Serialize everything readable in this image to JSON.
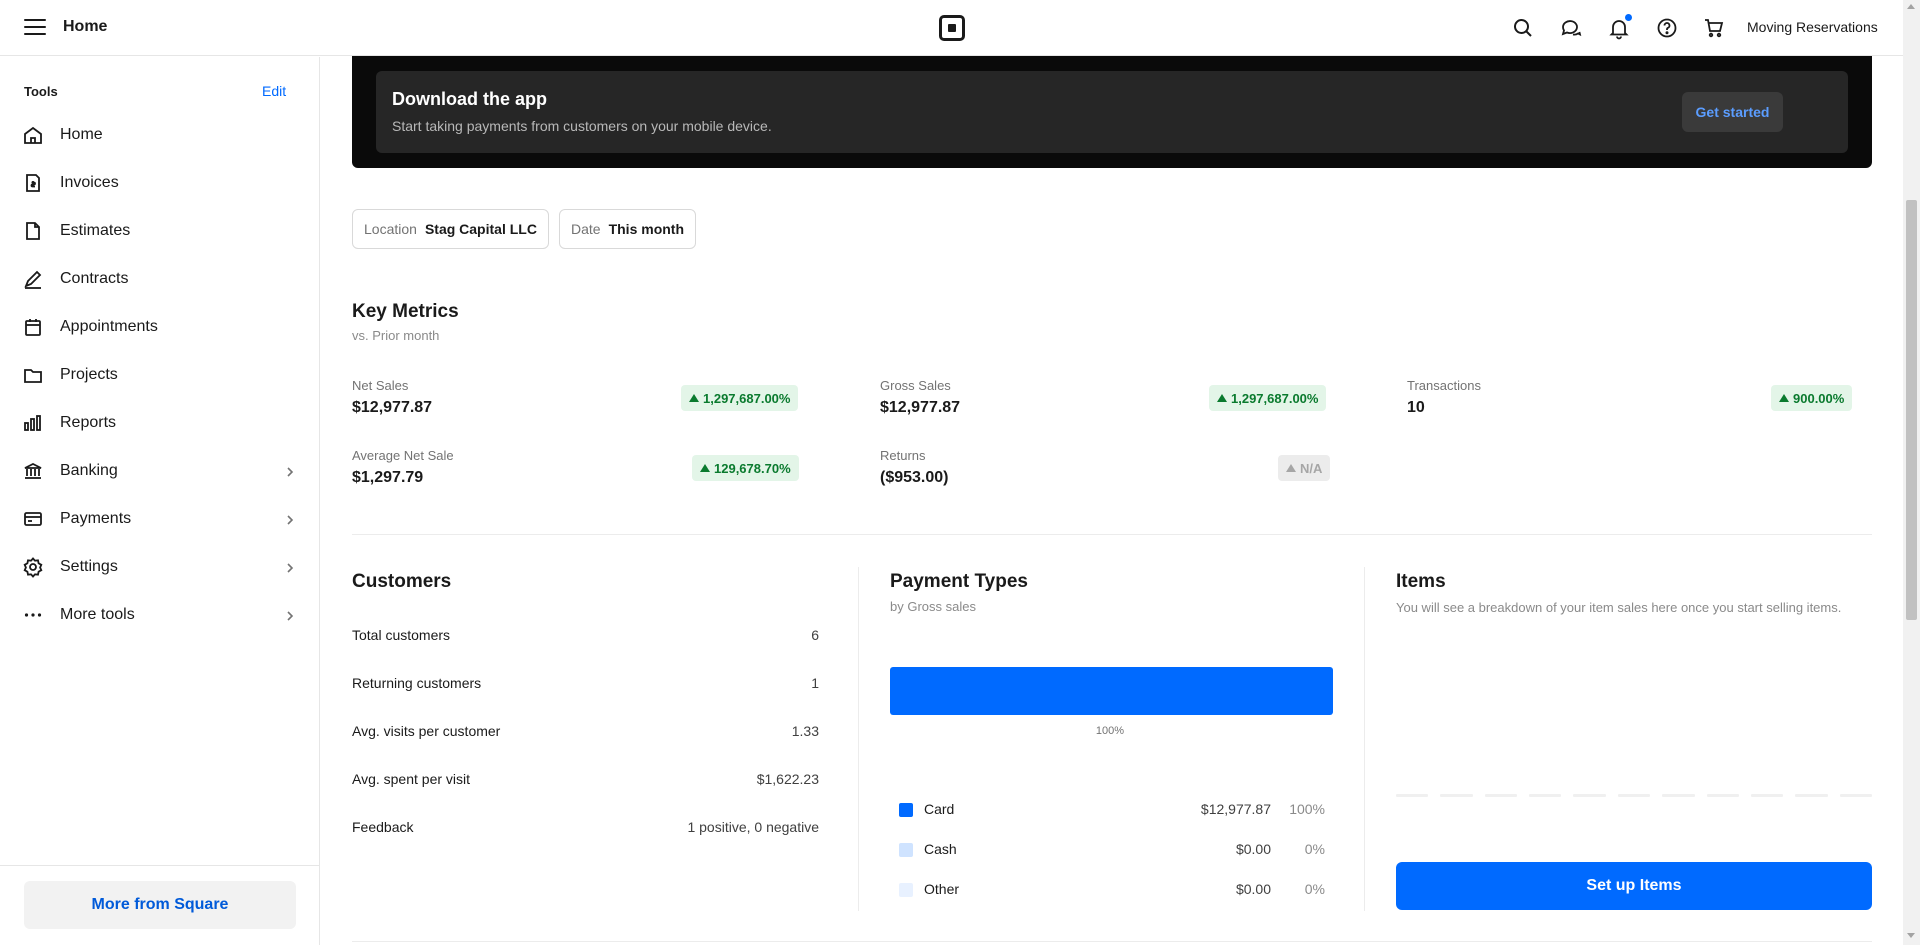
{
  "topbar": {
    "title": "Home",
    "account_name": "Moving Reservations",
    "icons": [
      "menu-icon",
      "square-logo-icon",
      "search-icon",
      "messages-icon",
      "bell-icon",
      "help-icon",
      "cart-icon"
    ]
  },
  "sidebar": {
    "tools_label": "Tools",
    "edit_label": "Edit",
    "items": [
      {
        "label": "Home",
        "icon": "home-icon"
      },
      {
        "label": "Invoices",
        "icon": "invoice-icon"
      },
      {
        "label": "Estimates",
        "icon": "document-icon"
      },
      {
        "label": "Contracts",
        "icon": "pen-icon"
      },
      {
        "label": "Appointments",
        "icon": "calendar-icon"
      },
      {
        "label": "Projects",
        "icon": "folder-icon"
      },
      {
        "label": "Reports",
        "icon": "bar-chart-icon"
      },
      {
        "label": "Banking",
        "icon": "bank-icon"
      },
      {
        "label": "Payments",
        "icon": "credit-card-icon"
      },
      {
        "label": "Settings",
        "icon": "gear-icon"
      },
      {
        "label": "More tools",
        "icon": "ellipsis-icon"
      }
    ],
    "more_from_square": "More from Square"
  },
  "banner": {
    "title": "Download the app",
    "subtitle": "Start taking payments from customers on your mobile device.",
    "cta": "Get started"
  },
  "filters": {
    "location_key": "Location",
    "location_value": "Stag Capital LLC",
    "date_key": "Date",
    "date_value": "This month"
  },
  "key_metrics": {
    "title": "Key Metrics",
    "subtitle": "vs. Prior month",
    "metrics": [
      {
        "label": "Net Sales",
        "value": "$12,977.87",
        "change": "1,297,687.00%"
      },
      {
        "label": "Gross Sales",
        "value": "$12,977.87",
        "change": "1,297,687.00%"
      },
      {
        "label": "Transactions",
        "value": "10",
        "change": "900.00%"
      },
      {
        "label": "Average Net Sale",
        "value": "$1,297.79",
        "change": "129,678.70%"
      },
      {
        "label": "Returns",
        "value": "($953.00)",
        "change": "N/A"
      }
    ]
  },
  "customers": {
    "title": "Customers",
    "rows": [
      {
        "label": "Total customers",
        "value": "6"
      },
      {
        "label": "Returning customers",
        "value": "1"
      },
      {
        "label": "Avg. visits per customer",
        "value": "1.33"
      },
      {
        "label": "Avg. spent per visit",
        "value": "$1,622.23"
      },
      {
        "label": "Feedback",
        "value": "1 positive, 0 negative"
      }
    ]
  },
  "payment_types": {
    "title": "Payment Types",
    "subtitle": "by Gross sales",
    "bar_percent_label": "100%",
    "rows": [
      {
        "name": "Card",
        "amount": "$12,977.87",
        "percent": "100%",
        "color": "#006aff"
      },
      {
        "name": "Cash",
        "amount": "$0.00",
        "percent": "0%",
        "color": "#cfe3ff"
      },
      {
        "name": "Other",
        "amount": "$0.00",
        "percent": "0%",
        "color": "#e8f1ff"
      }
    ]
  },
  "items": {
    "title": "Items",
    "subtitle": "You will see a breakdown of your item sales here once you start selling items.",
    "cta": "Set up Items"
  },
  "colors": {
    "accent": "#006aff",
    "positive": "#0a7a2e",
    "positive_bg": "#e3f5e8",
    "banner_bg": "#0a0a0a"
  }
}
